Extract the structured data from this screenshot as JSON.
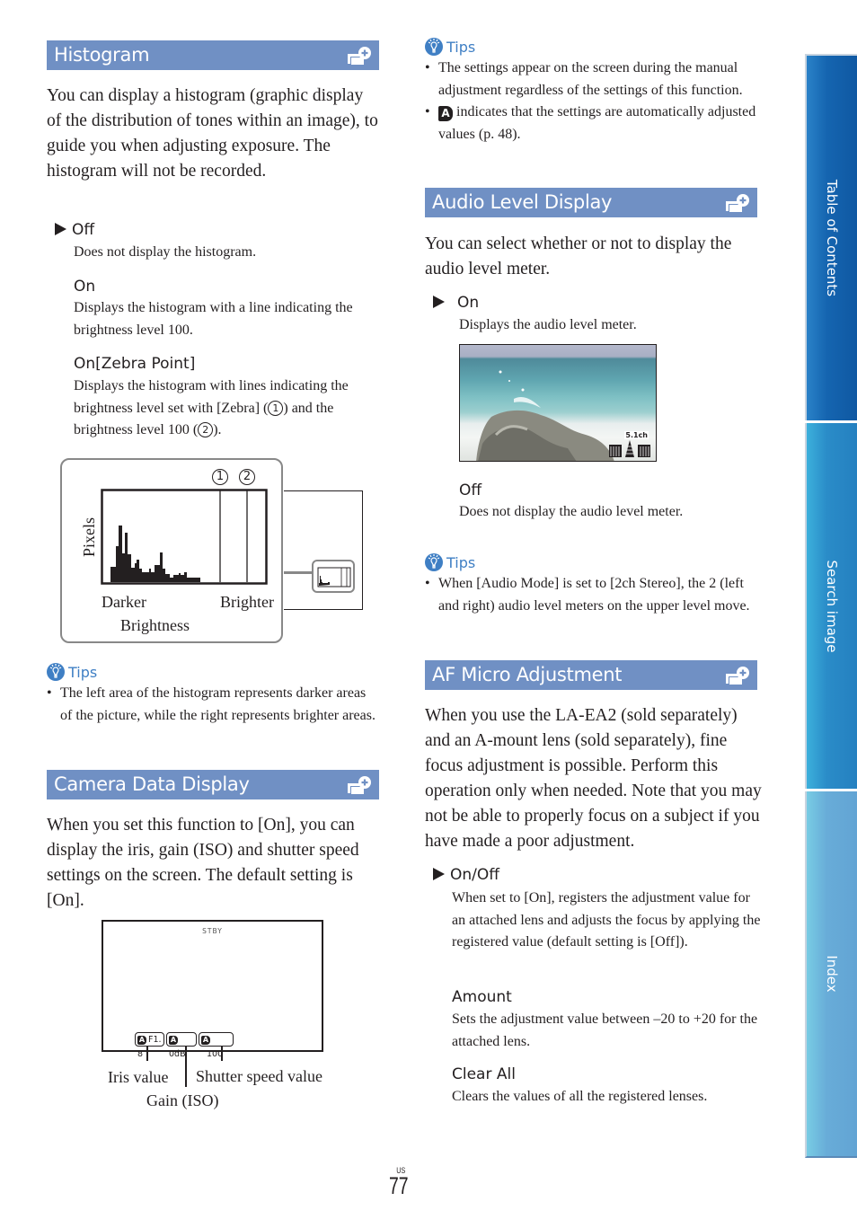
{
  "sections": {
    "histogram": {
      "title": "Histogram",
      "intro": "You can display a histogram (graphic display of the distribution of tones within an image), to guide you when adjusting exposure. The histogram will not be recorded.",
      "options": [
        {
          "label": "Off",
          "default": true,
          "desc": "Does not display the histogram."
        },
        {
          "label": "On",
          "default": false,
          "desc": "Displays the histogram with a line indicating the brightness level 100."
        },
        {
          "label": "On[Zebra Point]",
          "default": false,
          "desc_part1": "Displays the histogram with lines indicating the brightness level set with [Zebra] (",
          "desc_part2": ") and the brightness level 100 (",
          "desc_part3": ")."
        }
      ],
      "figure": {
        "marker1": "1",
        "marker2": "2",
        "y_label": "Pixels",
        "x_left": "Darker",
        "x_right": "Brighter",
        "x_label": "Brightness"
      },
      "tips_label": "Tips",
      "tips": [
        "The left area of the histogram represents darker areas of the picture, while the right represents brighter areas."
      ]
    },
    "camera_data": {
      "title": "Camera Data Display",
      "intro": "When you set this function to [On], you can display the iris, gain (ISO) and shutter speed settings on the screen. The default setting is [On].",
      "figure": {
        "status": "STBY",
        "iris_value": "F1. 8",
        "gain_value": "0dB",
        "shutter_value": "100",
        "auto_badge": "A",
        "label_iris": "Iris value",
        "label_gain": "Gain (ISO)",
        "label_shutter": "Shutter speed value"
      },
      "tips_label": "Tips",
      "tips": [
        {
          "text": "The settings appear on the screen during the manual adjustment regardless of the settings of this function."
        },
        {
          "icon": "A",
          "text": " indicates that the settings are automatically adjusted values (p. 48)."
        }
      ]
    },
    "audio_level": {
      "title": "Audio Level Display",
      "intro": "You can select whether or not to display the audio level meter.",
      "options": [
        {
          "label": "On",
          "default": true,
          "desc": "Displays the audio level meter."
        },
        {
          "label": "Off",
          "default": false,
          "desc": "Does not display the audio level meter."
        }
      ],
      "meter_label": "5.1ch",
      "tips_label": "Tips",
      "tips": [
        "When [Audio Mode] is set to [2ch Stereo], the 2 (left and right) audio level meters on the upper level move."
      ]
    },
    "af_micro": {
      "title": "AF Micro Adjustment",
      "intro": "When you use the LA-EA2 (sold separately) and an A-mount lens (sold separately), fine focus adjustment is possible. Perform this operation only when needed. Note that you may not be able to properly focus on a subject if you have made a poor adjustment.",
      "options": [
        {
          "label": "On/Off",
          "default": true,
          "desc": "When set to [On], registers the adjustment value for an attached lens and adjusts the focus by applying the registered value (default setting is [Off])."
        },
        {
          "label": "Amount",
          "default": false,
          "desc": "Sets the adjustment value between –20 to +20 for the attached lens."
        },
        {
          "label": "Clear All",
          "default": false,
          "desc": "Clears the values of all the registered lenses."
        }
      ]
    }
  },
  "side_tabs": [
    {
      "label": "Table of Contents"
    },
    {
      "label": "Search image"
    },
    {
      "label": "Index"
    }
  ],
  "page": {
    "region": "US",
    "number": "77"
  },
  "colors": {
    "section_bar": "#7090c4",
    "tips_blue": "#3f7fc4",
    "tab_toc": "#1560a8",
    "tab_search": "#2a86c4",
    "tab_index": "#6aa8d4"
  }
}
